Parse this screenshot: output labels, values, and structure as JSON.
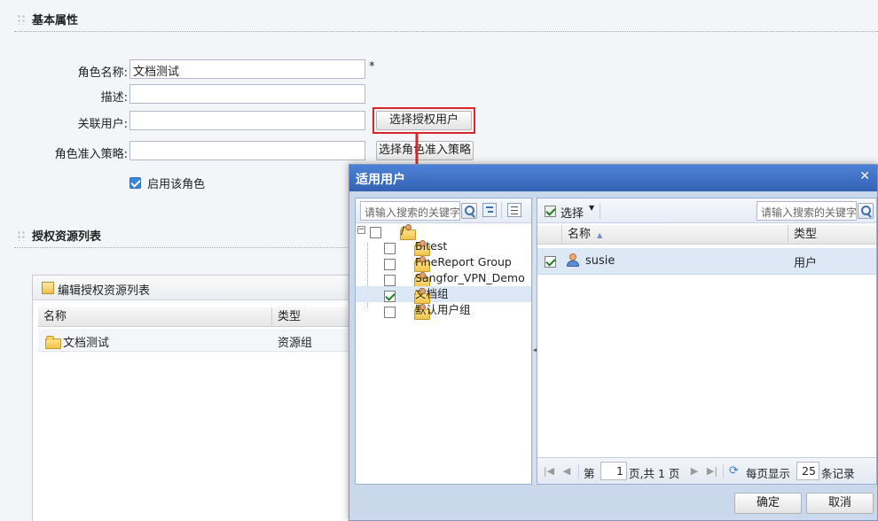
{
  "basic": {
    "section_title": "基本属性",
    "role_name_label": "角色名称:",
    "role_name_value": "文档测试",
    "required_mark": "*",
    "desc_label": "描述:",
    "assoc_user_label": "关联用户:",
    "select_user_button": "选择授权用户",
    "policy_label": "角色准入策略:",
    "select_policy_button": "选择角色准入策略",
    "enable_role_label": "启用该角色"
  },
  "resource": {
    "section_title": "授权资源列表",
    "edit_title": "编辑授权资源列表",
    "columns": [
      "名称",
      "类型"
    ],
    "rows": [
      {
        "name": "文档测试",
        "type": "资源组"
      }
    ]
  },
  "dialog": {
    "title": "适用用户",
    "close_glyph": "✕",
    "left_search_placeholder": "请输入搜索的关键字",
    "tree": [
      {
        "label": "/",
        "checked": false
      },
      {
        "label": "BItest",
        "checked": false
      },
      {
        "label": "FineReport Group",
        "checked": false
      },
      {
        "label": "Sangfor_VPN_Demo",
        "checked": false
      },
      {
        "label": "文档组",
        "checked": true
      },
      {
        "label": "默认用户组",
        "checked": false
      }
    ],
    "select_button": "选择",
    "right_search_placeholder": "请输入搜索的关键字",
    "grid_columns": [
      "名称",
      "类型"
    ],
    "grid_rows": [
      {
        "name": "susie",
        "type": "用户",
        "checked": true
      }
    ],
    "pager": {
      "page_prefix": "第",
      "page_value": "1",
      "page_suffix": "页,共 1 页",
      "per_page_prefix": "每页显示",
      "per_page_value": "25",
      "per_page_suffix": "条记录"
    },
    "ok_button": "确定",
    "cancel_button": "取消"
  },
  "colors": {
    "dialog_header": "#3a6cc0",
    "highlight_border": "#d9262b",
    "selected_row": "#dde8f6"
  }
}
